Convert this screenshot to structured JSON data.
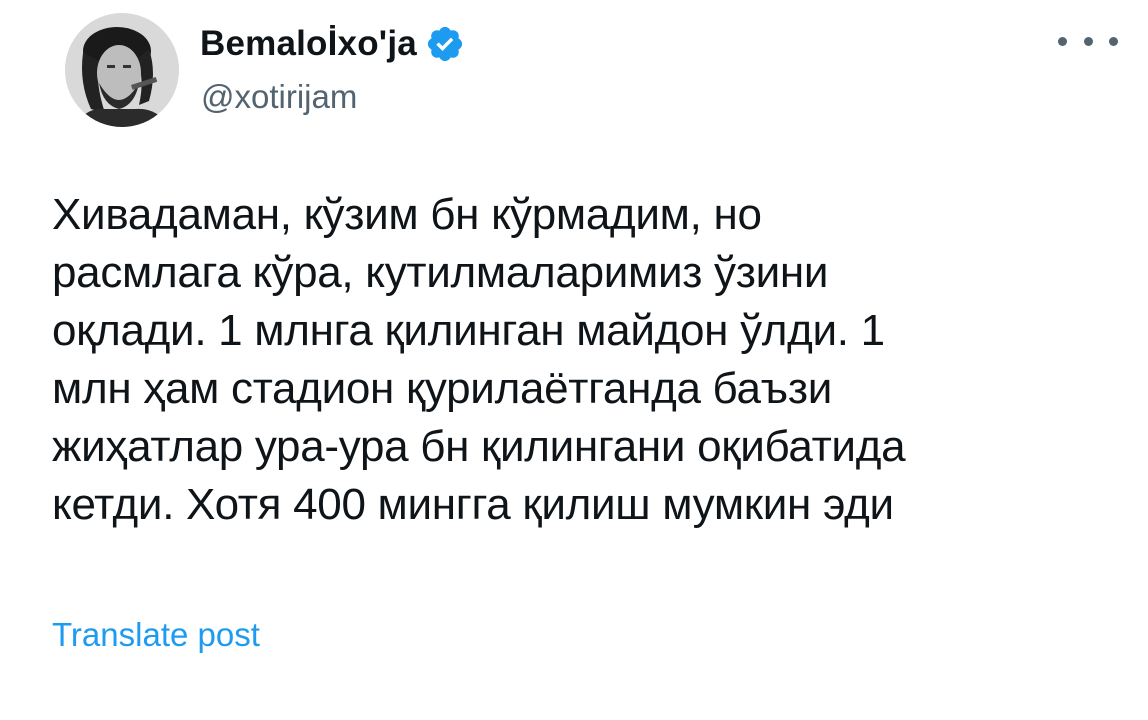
{
  "author": {
    "display_name": "Bemaloİxo'ja",
    "handle": "@xotirijam",
    "verified": true,
    "avatar_icon": "profile-photo-avatar"
  },
  "colors": {
    "text": "#0f1419",
    "secondary": "#536471",
    "accent": "#1d9bf0"
  },
  "more_icon": "more-horizontal-icon",
  "verified_icon": "verified-badge-icon",
  "tweet": {
    "lines": [
      "Хивадаман, кўзим бн кўрмадим, но",
      "расмлага кўра, кутилмаларимиз ўзини",
      "оқлади. 1 млнга қилинган майдон ўлди. 1",
      "млн ҳам стадион қурилаётганда баъзи",
      "жиҳатлар ура-ура бн қилингани оқибатида",
      "кетди. Хотя 400 мингга қилиш мумкин эди"
    ]
  },
  "translate_label": "Translate post"
}
